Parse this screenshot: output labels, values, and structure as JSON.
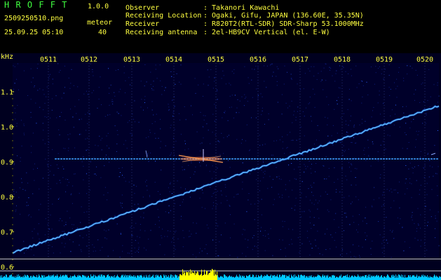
{
  "header": {
    "app_name": "H R O F F T",
    "version": "1.0.0",
    "filename": "2509250510.png",
    "timestamp": "25.09.25 05:10",
    "counter_label": "meteor",
    "counter_value": "40",
    "info_keys": [
      "Observer",
      "Receiving Location",
      "Receiver",
      "Receiving antenna"
    ],
    "info_values": [
      ": Takanori Kawachi",
      ": Ogaki, Gifu, JAPAN (136.60E, 35.35N)",
      ": R820T2(RTL-SDR) SDR-Sharp 53.1000MHz",
      ": 2el-HB9CV Vertical (el. E-W)"
    ]
  },
  "axis": {
    "y_unit": "kHz",
    "y_ticks": [
      "1.1",
      "1.0",
      "0.9",
      "0.8",
      "0.7",
      "0.6"
    ],
    "time_ticks": [
      "0511",
      "0512",
      "0513",
      "0514",
      "0515",
      "0516",
      "0517",
      "0518",
      "0519",
      "0520"
    ]
  },
  "chart_data": {
    "type": "heatmap",
    "x_ticks": [
      "0511",
      "0512",
      "0513",
      "0514",
      "0515",
      "0516",
      "0517",
      "0518",
      "0519",
      "0520"
    ],
    "y_ticks": [
      "1.1",
      "1.0",
      "0.9",
      "0.8",
      "0.7",
      "0.6"
    ],
    "ylabel": "kHz",
    "ylim": [
      0.58,
      1.14
    ],
    "traces": [
      {
        "kind": "drifting-carrier",
        "from": {
          "time": "0510",
          "khz": 0.64
        },
        "to": {
          "time": "0520",
          "khz": 1.06
        }
      },
      {
        "kind": "horizontal-carrier",
        "khz": 0.908
      }
    ],
    "colors": {
      "background": "#00002a",
      "trace": "#6fd0ff",
      "meteor": "#ff8040",
      "activity_bar": "#00c8ff",
      "activity_peak": "#ffff00",
      "text_header": "#ffff40",
      "text_info": "#40ff40"
    }
  }
}
